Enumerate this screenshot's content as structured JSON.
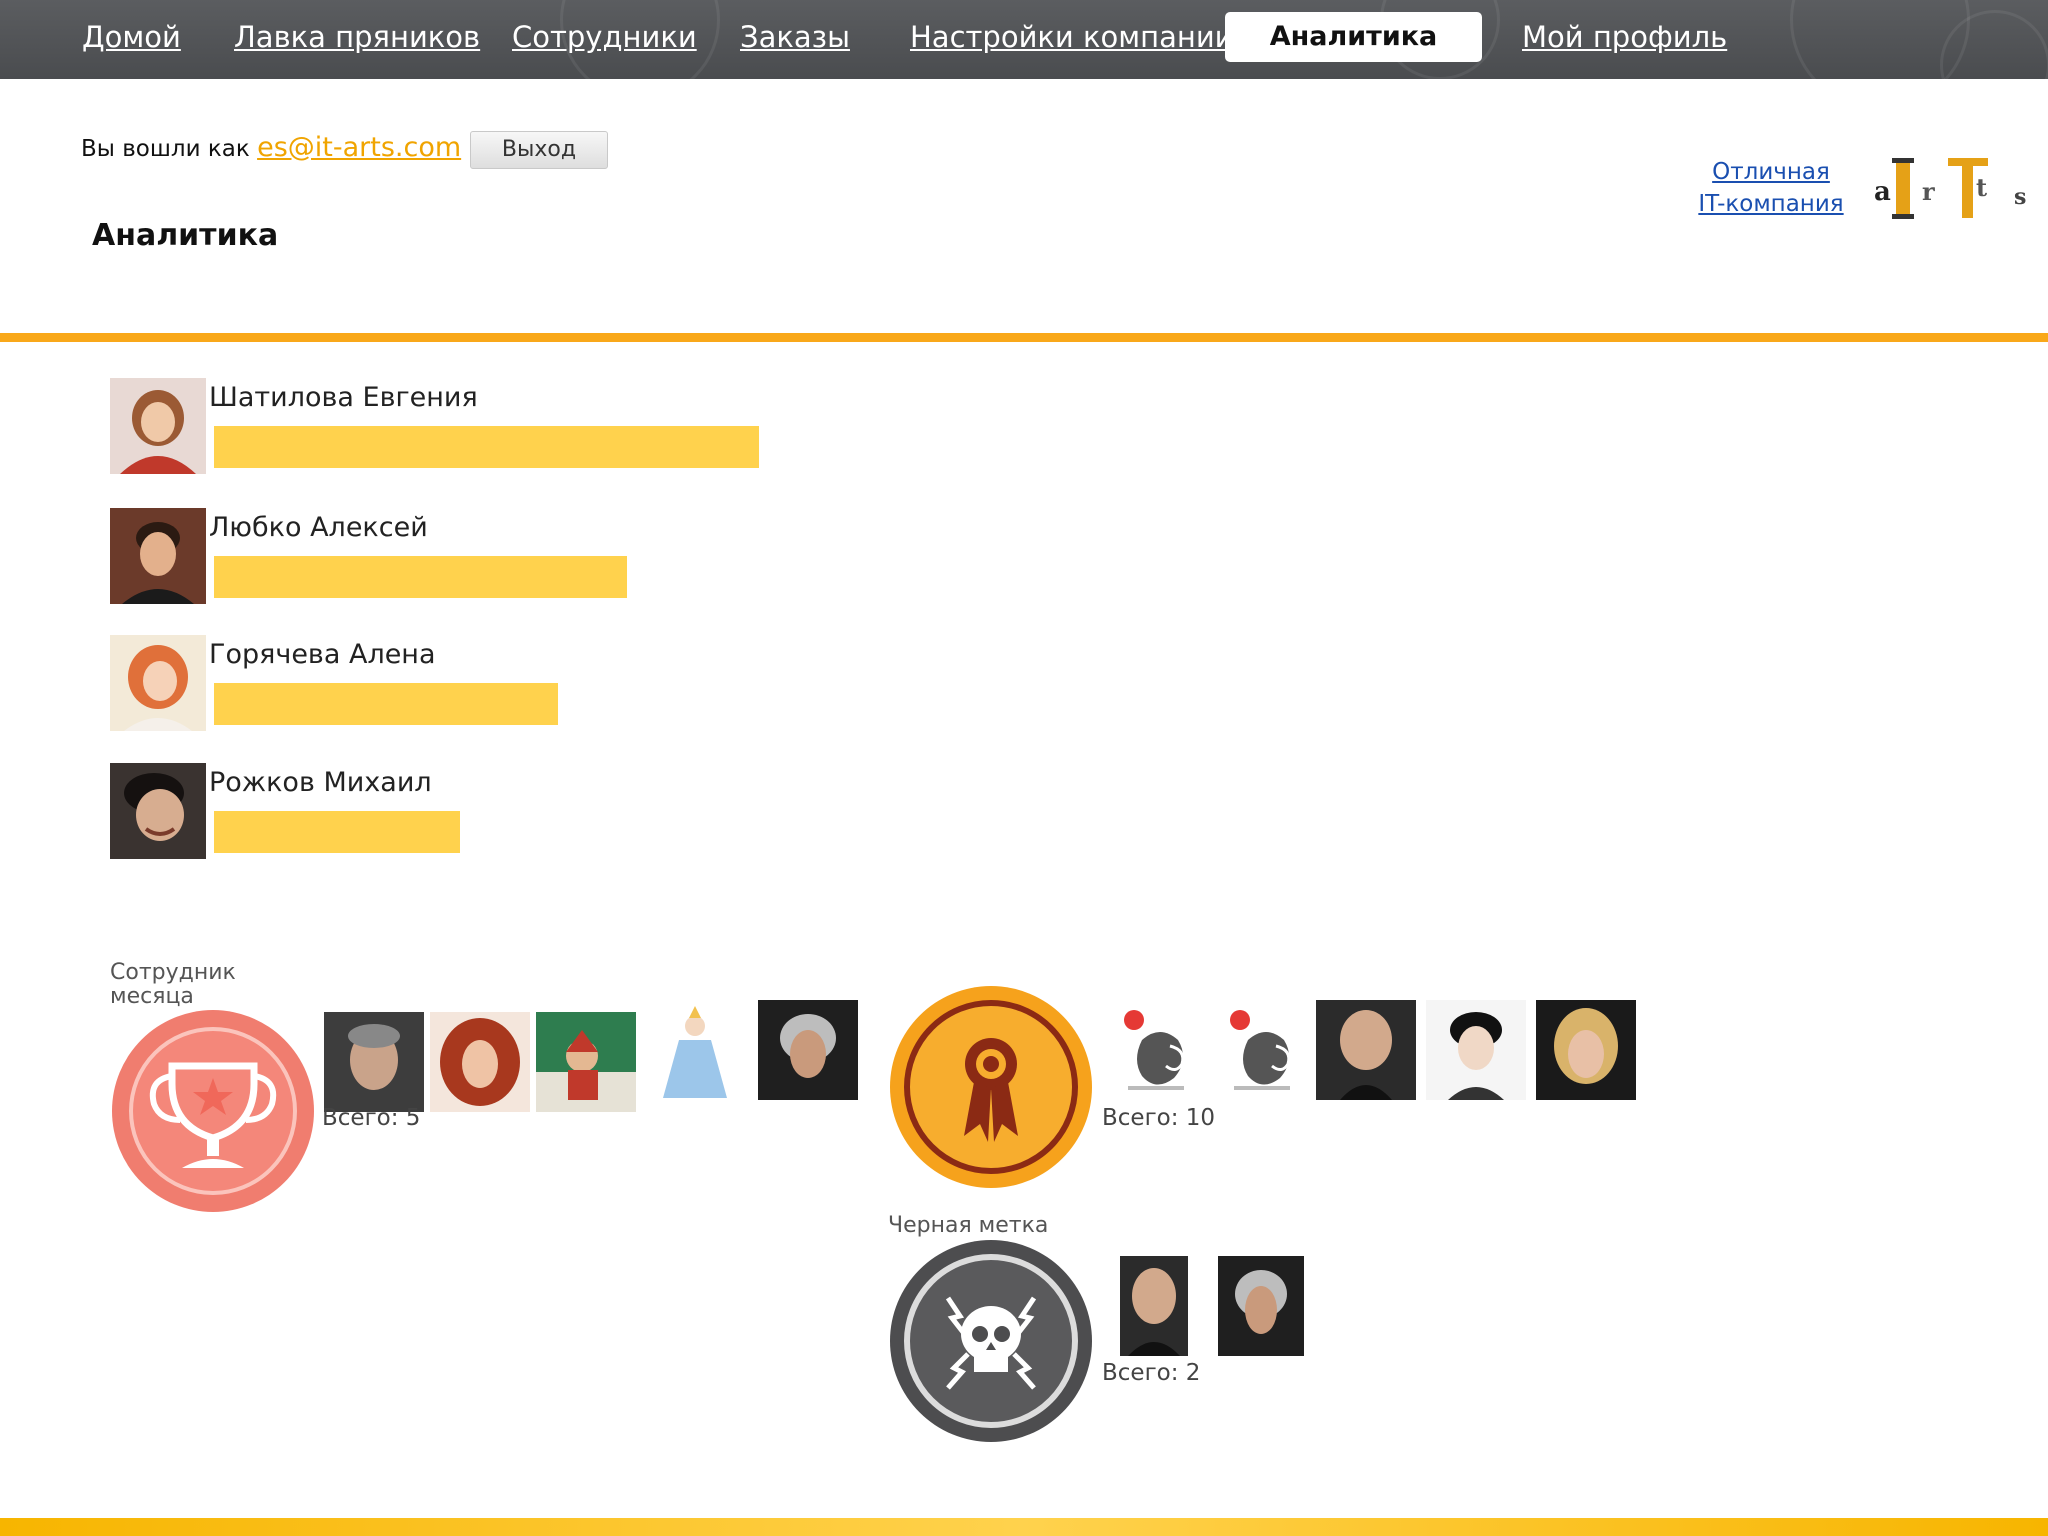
{
  "nav": {
    "items": [
      {
        "label": "Домой"
      },
      {
        "label": "Лавка пряников"
      },
      {
        "label": "Сотрудники"
      },
      {
        "label": "Заказы"
      },
      {
        "label": "Настройки компании"
      },
      {
        "label": "Аналитика"
      },
      {
        "label": "Мой профиль"
      }
    ],
    "active_index": 5
  },
  "header": {
    "logged_in_as": "Вы вошли как",
    "email": "es@it-arts.com",
    "logout_label": "Выход",
    "page_title": "Аналитика",
    "promo_line1": "Отличная",
    "promo_line2": "IT-компания"
  },
  "employees": [
    {
      "name": "Шатилова Евгения",
      "value": 545
    },
    {
      "name": "Любко Алексей",
      "value": 413
    },
    {
      "name": "Горячева Алена",
      "value": 344
    },
    {
      "name": "Рожков Михаил",
      "value": 246
    }
  ],
  "badges": {
    "employee_of_month": {
      "caption_line1": "Сотрудник",
      "caption_line2": "месяца",
      "total": "Всего: 5",
      "color": "#f06a5e"
    },
    "award": {
      "total": "Всего: 10",
      "color": "#f7a21a"
    },
    "black_mark": {
      "caption": "Черная метка",
      "total": "Всего: 2",
      "color": "#4d4d4f"
    }
  },
  "colors": {
    "accent": "#f9a81a",
    "bar": "#ffd24d",
    "nav_bg": "#525457",
    "link": "#1a4fb0"
  }
}
